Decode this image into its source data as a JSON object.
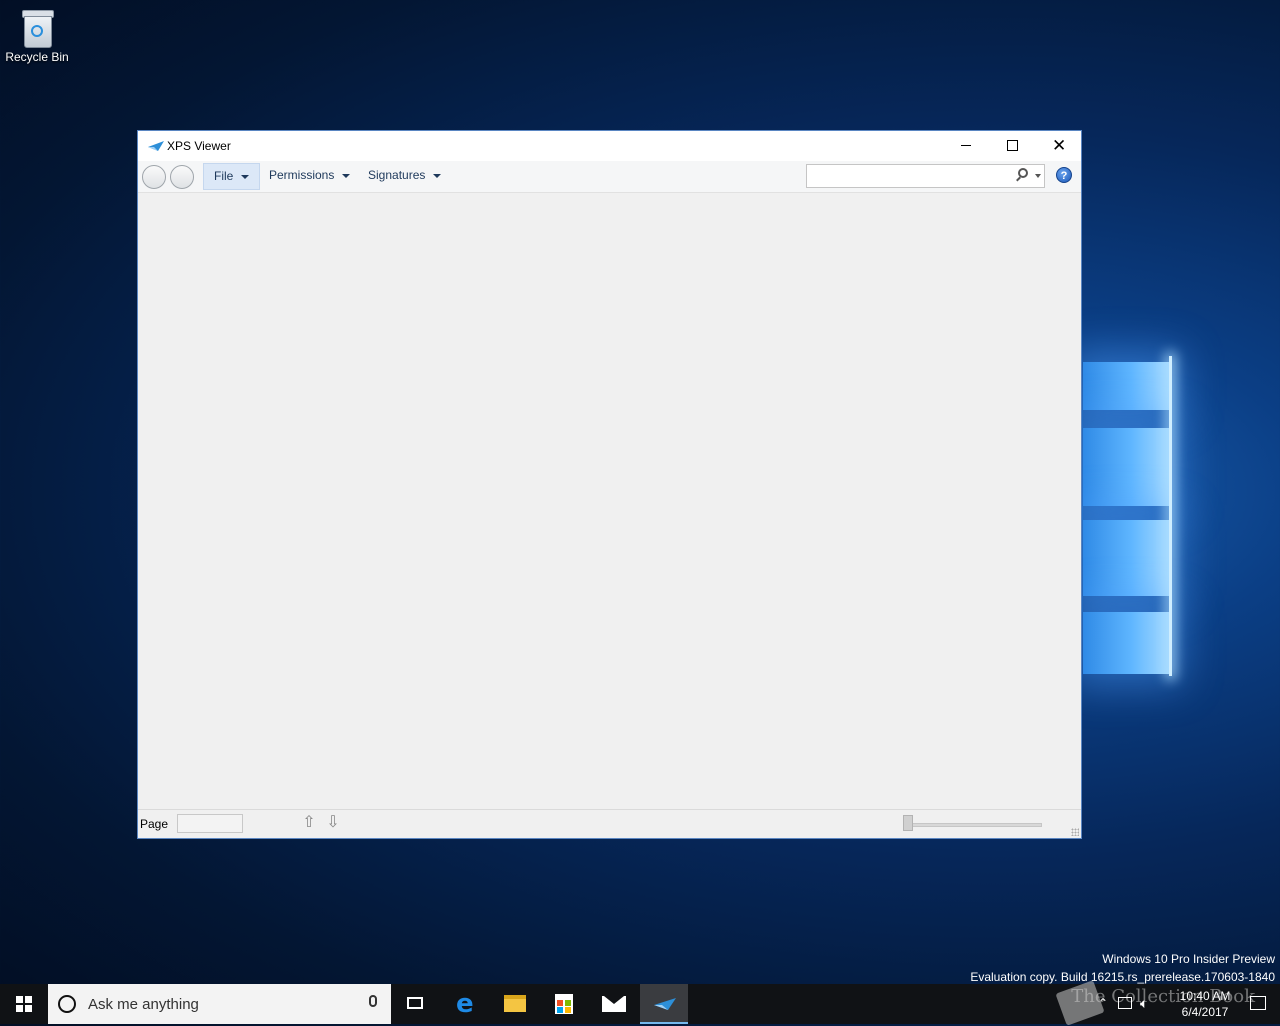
{
  "desktop": {
    "recycle_bin_label": "Recycle Bin"
  },
  "window": {
    "title": "XPS Viewer",
    "controls": {
      "minimize": "minimize",
      "maximize": "maximize",
      "close": "close"
    },
    "menus": {
      "file": "File",
      "permissions": "Permissions",
      "signatures": "Signatures"
    },
    "search": {
      "placeholder": "",
      "value": ""
    },
    "help_label": "?",
    "status": {
      "page_label": "Page",
      "page_value": ""
    }
  },
  "edition": {
    "line1": "Windows 10 Pro Insider Preview",
    "line2": "Evaluation copy. Build 16215.rs_prerelease.170603-1840"
  },
  "taskbar": {
    "search_placeholder": "Ask me anything",
    "clock_time": "10:40 AM",
    "clock_date": "6/4/2017",
    "watermark": "The Collection Book",
    "active_app": "XPS Viewer"
  },
  "colors": {
    "accent": "#76b9ed",
    "taskbar": "#101215",
    "window_border": "#5a86c2"
  }
}
